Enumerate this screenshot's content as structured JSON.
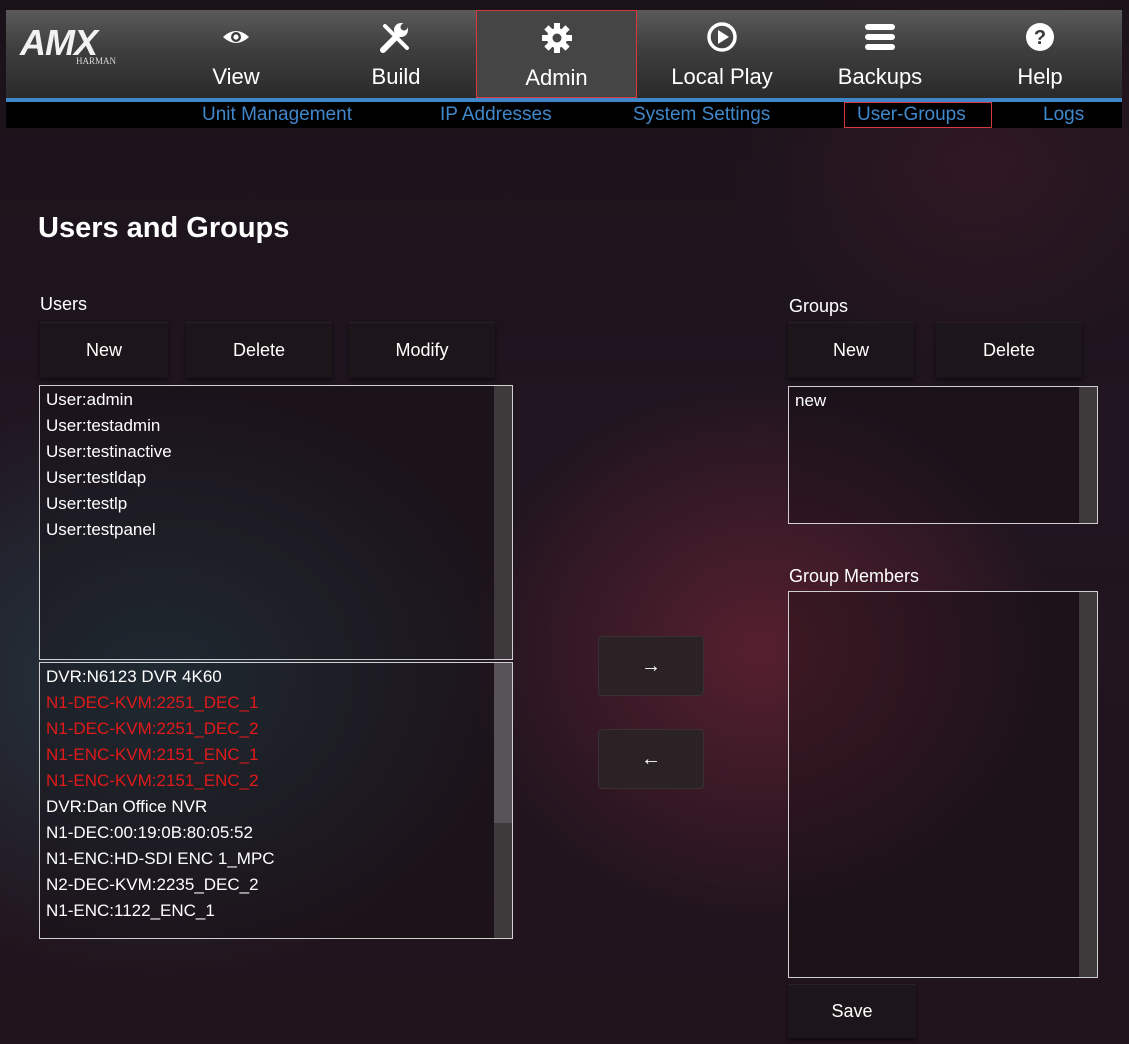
{
  "logo": {
    "brand": "AMX",
    "sub": "HARMAN"
  },
  "nav": {
    "view": "View",
    "build": "Build",
    "admin": "Admin",
    "local_play": "Local Play",
    "backups": "Backups",
    "help": "Help"
  },
  "subnav": {
    "unit_management": "Unit Management",
    "ip_addresses": "IP Addresses",
    "system_settings": "System Settings",
    "user_groups": "User-Groups",
    "logs": "Logs"
  },
  "page_title": "Users and Groups",
  "users": {
    "label": "Users",
    "new": "New",
    "delete": "Delete",
    "modify": "Modify",
    "items": [
      "User:admin",
      "User:testadmin",
      "User:testinactive",
      "User:testldap",
      "User:testlp",
      "User:testpanel"
    ]
  },
  "devices": {
    "items": [
      {
        "text": "DVR:N6123 DVR 4K60",
        "red": false
      },
      {
        "text": "N1-DEC-KVM:2251_DEC_1",
        "red": true
      },
      {
        "text": "N1-DEC-KVM:2251_DEC_2",
        "red": true
      },
      {
        "text": "N1-ENC-KVM:2151_ENC_1",
        "red": true
      },
      {
        "text": "N1-ENC-KVM:2151_ENC_2",
        "red": true
      },
      {
        "text": "DVR:Dan Office NVR",
        "red": false
      },
      {
        "text": "N1-DEC:00:19:0B:80:05:52",
        "red": false
      },
      {
        "text": "N1-ENC:HD-SDI ENC 1_MPC",
        "red": false
      },
      {
        "text": "N2-DEC-KVM:2235_DEC_2",
        "red": false
      },
      {
        "text": "N1-ENC:1122_ENC_1",
        "red": false
      }
    ]
  },
  "arrows": {
    "add": "→",
    "remove": "←"
  },
  "groups": {
    "label": "Groups",
    "new": "New",
    "delete": "Delete",
    "items": [
      "new"
    ]
  },
  "group_members": {
    "label": "Group Members",
    "items": []
  },
  "save": "Save",
  "colors": {
    "accent_blue": "#3f88cc",
    "active_border": "#d63a3a",
    "error_red": "#e01a1a"
  }
}
